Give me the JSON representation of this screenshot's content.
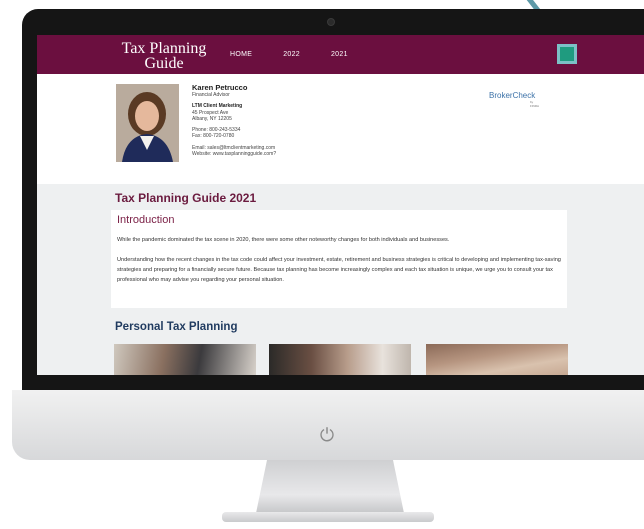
{
  "site": {
    "logo": "Tax Planning Guide",
    "nav": [
      "HOME",
      "2022",
      "2021"
    ]
  },
  "advisor": {
    "name": "Karen Petrucco",
    "title": "Financial Advisor",
    "company": "LTM Client Marketing",
    "address1": "45 Prospect Ave",
    "address2": "Albany, NY 12205",
    "phone": "Phone: 800-243-5334",
    "fax": "Fax: 800-720-0780",
    "email": "Email: sales@ltmclientmarketing.com",
    "website": "Website: www.taxplanningguide.com?"
  },
  "brokercheck": {
    "label": "BrokerCheck",
    "sub": "by FINRA"
  },
  "page": {
    "title": "Tax Planning Guide 2021",
    "intro_heading": "Introduction",
    "intro_p1": "While the pandemic dominated the tax scene in 2020, there were some other noteworthy changes for both individuals and businesses.",
    "intro_p2": "Understanding how the recent changes in the tax code could affect your investment, estate, retirement and business strategies is critical to developing and implementing tax-saving strategies and preparing for a financially secure future. Because tax planning has become increasingly complex and each tax situation is unique, we urge you to consult your tax professional who may advise you regarding your personal situation.",
    "section_heading": "Personal Tax Planning"
  },
  "icons": {
    "power": "power-icon"
  },
  "colors": {
    "header": "#6b0f3f",
    "heading": "#6b1b3f",
    "section": "#1f3a5f",
    "accent": "#1f9b7f"
  }
}
